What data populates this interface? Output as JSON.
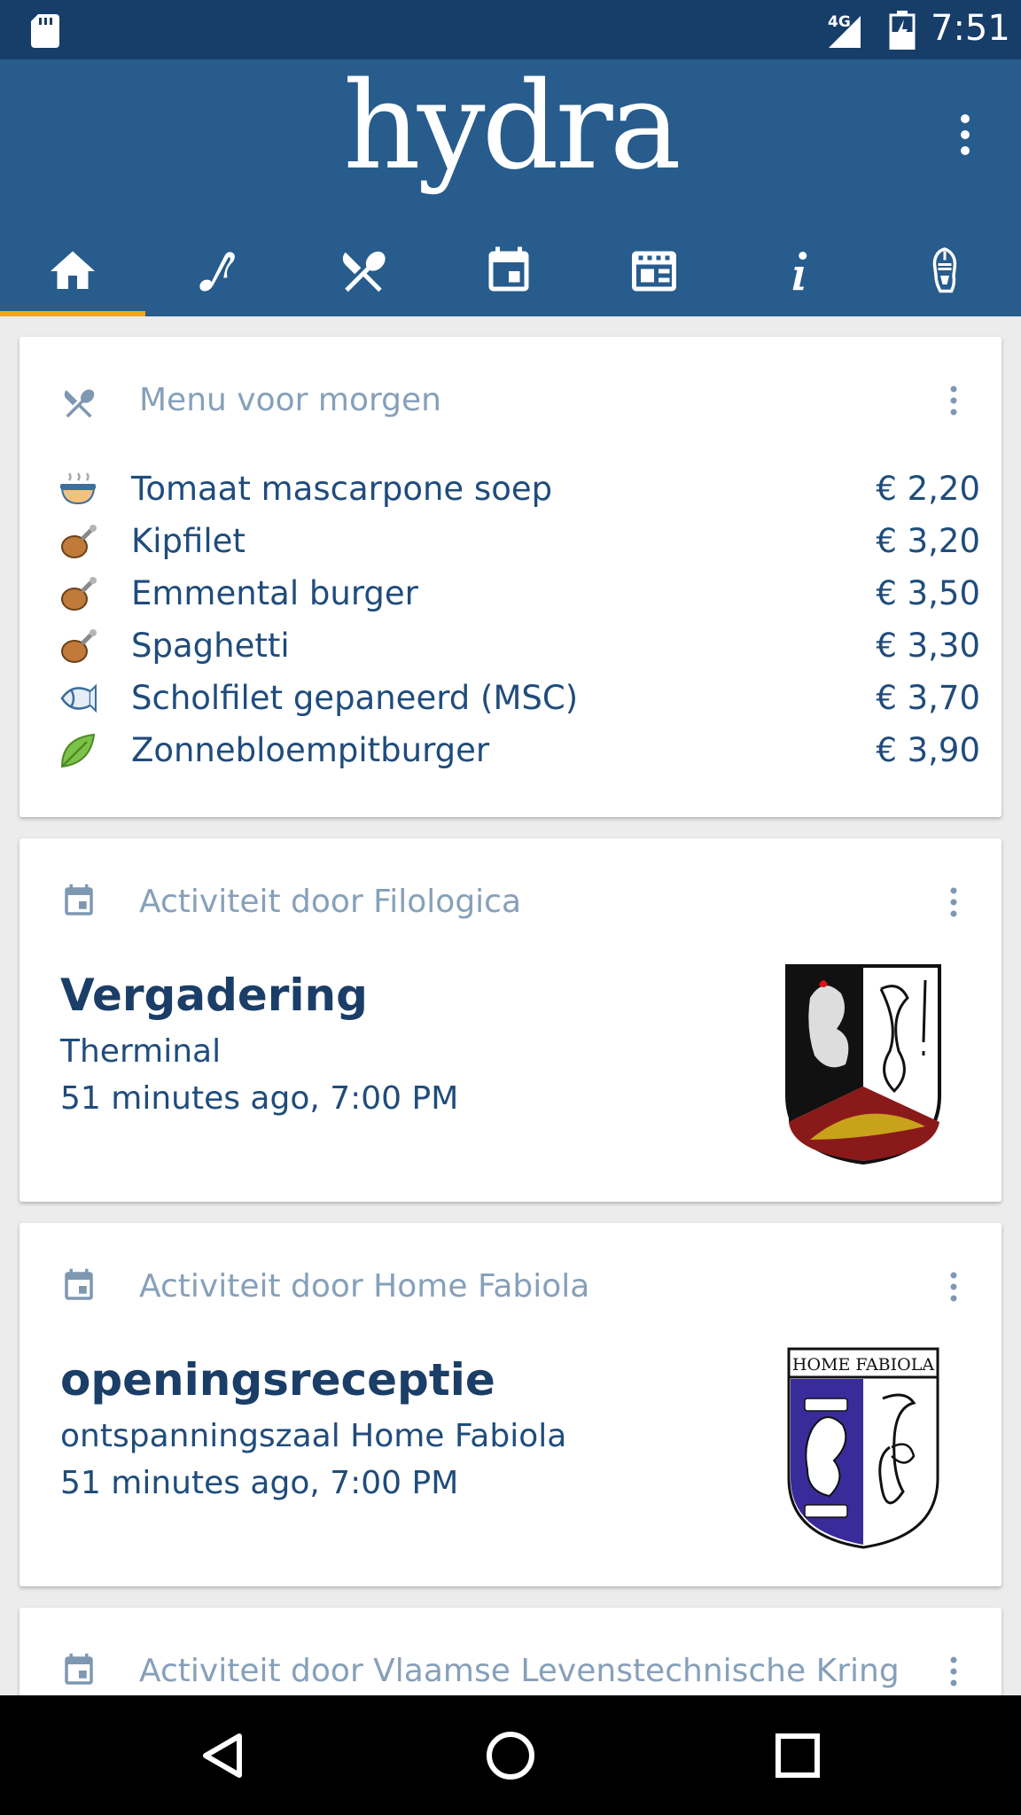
{
  "status_bar": {
    "network": "4G",
    "time": "7:51"
  },
  "app": {
    "logo": "hydra",
    "tabs": [
      {
        "name": "home",
        "icon": "home-icon",
        "active": true
      },
      {
        "name": "music",
        "icon": "note-icon"
      },
      {
        "name": "resto",
        "icon": "cutlery-icon"
      },
      {
        "name": "calendar",
        "icon": "calendar-icon"
      },
      {
        "name": "news",
        "icon": "news-icon"
      },
      {
        "name": "info",
        "icon": "info-icon"
      },
      {
        "name": "urgent",
        "icon": "knight-icon"
      }
    ],
    "accent": "#f7a521",
    "primary": "#275c8d"
  },
  "menu_card": {
    "title": "Menu voor morgen",
    "items": [
      {
        "icon": "soup-icon",
        "name": "Tomaat mascarpone soep",
        "price": "€ 2,20"
      },
      {
        "icon": "meat-icon",
        "name": "Kipfilet",
        "price": "€ 3,20"
      },
      {
        "icon": "meat-icon",
        "name": "Emmental burger",
        "price": "€ 3,50"
      },
      {
        "icon": "meat-icon",
        "name": "Spaghetti",
        "price": "€ 3,30"
      },
      {
        "icon": "fish-icon",
        "name": "Scholfilet gepaneerd (MSC)",
        "price": "€ 3,70"
      },
      {
        "icon": "leaf-icon",
        "name": "Zonnebloempitburger",
        "price": "€ 3,90"
      }
    ]
  },
  "activities": [
    {
      "header": "Activiteit door Filologica",
      "title": "Vergadering",
      "location": "Therminal",
      "time": "51 minutes ago, 7:00 PM"
    },
    {
      "header": "Activiteit door Home Fabiola",
      "title": "openingsreceptie",
      "location": "ontspanningszaal Home Fabiola",
      "time": "51 minutes ago, 7:00 PM",
      "crest_text": "HOME FABIOLA"
    },
    {
      "header": "Activiteit door Vlaamse Levenstechnische Kring"
    }
  ]
}
